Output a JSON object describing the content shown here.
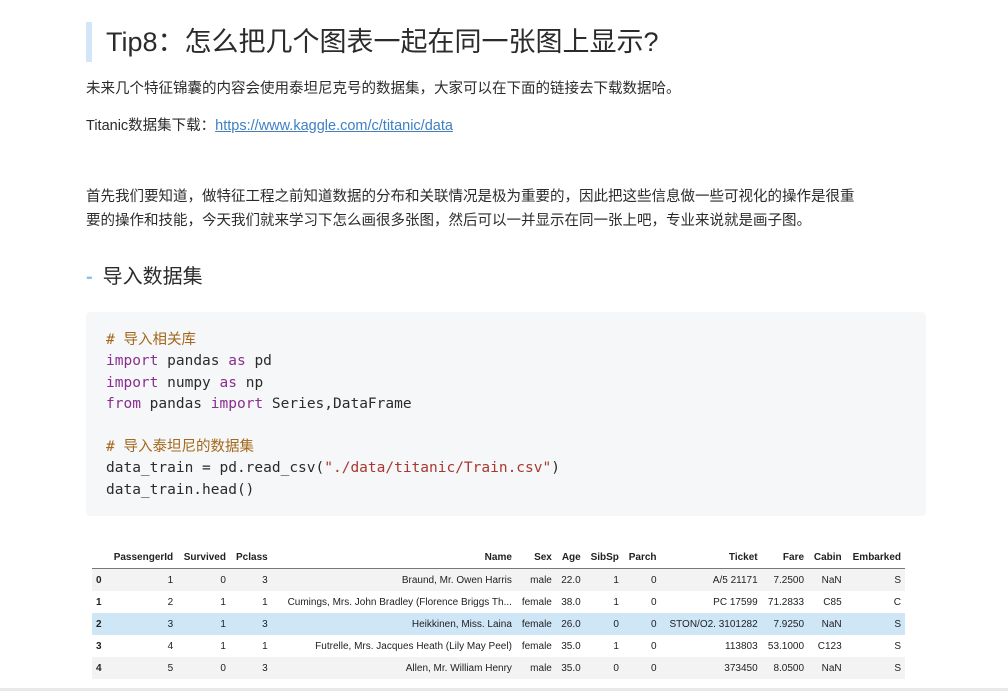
{
  "heading": "Tip8：怎么把几个图表一起在同一张图上显示?",
  "intro": "未来几个特征锦囊的内容会使用泰坦尼克号的数据集，大家可以在下面的链接去下载数据哈。",
  "download_label": "Titanic数据集下载：",
  "download_link": "https://www.kaggle.com/c/titanic/data",
  "para_line1": "首先我们要知道，做特征工程之前知道数据的分布和关联情况是极为重要的，因此把这些信息做一些可视化的操作是很重",
  "para_line2": "要的操作和技能，今天我们就来学习下怎么画很多张图，然后可以一并显示在同一张上吧，专业来说就是画子图。",
  "section_title": "导入数据集",
  "code": {
    "comment1": "# 导入相关库",
    "kw_import": "import",
    "kw_as": "as",
    "kw_from": "from",
    "mod_pandas": "pandas",
    "alias_pd": "pd",
    "mod_numpy": "numpy",
    "alias_np": "np",
    "import_names": "Series,DataFrame",
    "comment2": "# 导入泰坦尼的数据集",
    "read_prefix": "data_train = pd.read_csv(",
    "read_path": "\"./data/titanic/Train.csv\"",
    "read_suffix": ")",
    "head_call": "data_train.head()"
  },
  "table": {
    "columns": [
      "PassengerId",
      "Survived",
      "Pclass",
      "Name",
      "Sex",
      "Age",
      "SibSp",
      "Parch",
      "Ticket",
      "Fare",
      "Cabin",
      "Embarked"
    ],
    "rows": [
      {
        "index": "0",
        "cells": [
          "1",
          "0",
          "3",
          "Braund, Mr. Owen Harris",
          "male",
          "22.0",
          "1",
          "0",
          "A/5 21171",
          "7.2500",
          "NaN",
          "S"
        ]
      },
      {
        "index": "1",
        "cells": [
          "2",
          "1",
          "1",
          "Cumings, Mrs. John Bradley (Florence Briggs Th...",
          "female",
          "38.0",
          "1",
          "0",
          "PC 17599",
          "71.2833",
          "C85",
          "C"
        ]
      },
      {
        "index": "2",
        "cells": [
          "3",
          "1",
          "3",
          "Heikkinen, Miss. Laina",
          "female",
          "26.0",
          "0",
          "0",
          "STON/O2. 3101282",
          "7.9250",
          "NaN",
          "S"
        ]
      },
      {
        "index": "3",
        "cells": [
          "4",
          "1",
          "1",
          "Futrelle, Mrs. Jacques Heath (Lily May Peel)",
          "female",
          "35.0",
          "1",
          "0",
          "113803",
          "53.1000",
          "C123",
          "S"
        ]
      },
      {
        "index": "4",
        "cells": [
          "5",
          "0",
          "3",
          "Allen, Mr. William Henry",
          "male",
          "35.0",
          "0",
          "0",
          "373450",
          "8.0500",
          "NaN",
          "S"
        ]
      }
    ],
    "highlighted_row": 2
  }
}
